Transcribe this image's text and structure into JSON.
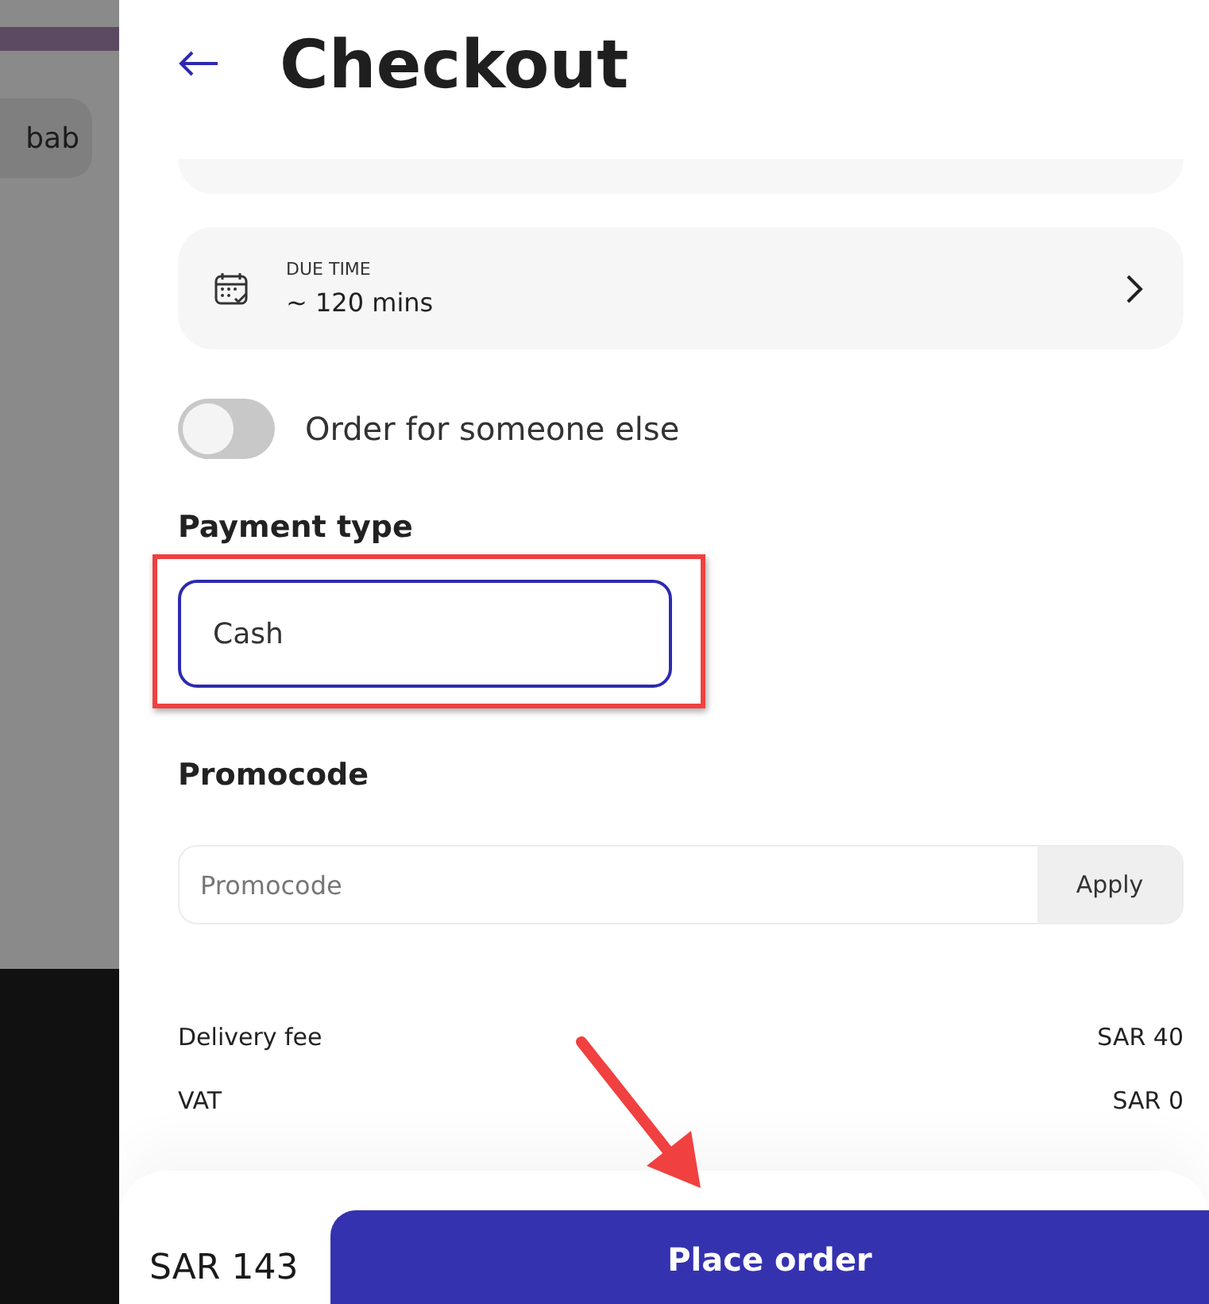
{
  "backdrop": {
    "chip": "bab"
  },
  "header": {
    "title": "Checkout"
  },
  "due_time": {
    "label": "DUE TIME",
    "value": "~ 120 mins"
  },
  "toggle": {
    "label": "Order for someone else",
    "on": false
  },
  "payment": {
    "heading": "Payment type",
    "value": "Cash"
  },
  "promocode": {
    "heading": "Promocode",
    "placeholder": "Promocode",
    "button": "Apply"
  },
  "fees": [
    {
      "label": "Delivery fee",
      "amount": "SAR 40"
    },
    {
      "label": "VAT",
      "amount": "SAR 0"
    }
  ],
  "footer": {
    "total": "SAR 143",
    "button": "Place order"
  },
  "annotations": {
    "highlight_frame": true,
    "pointer_arrow": true
  }
}
